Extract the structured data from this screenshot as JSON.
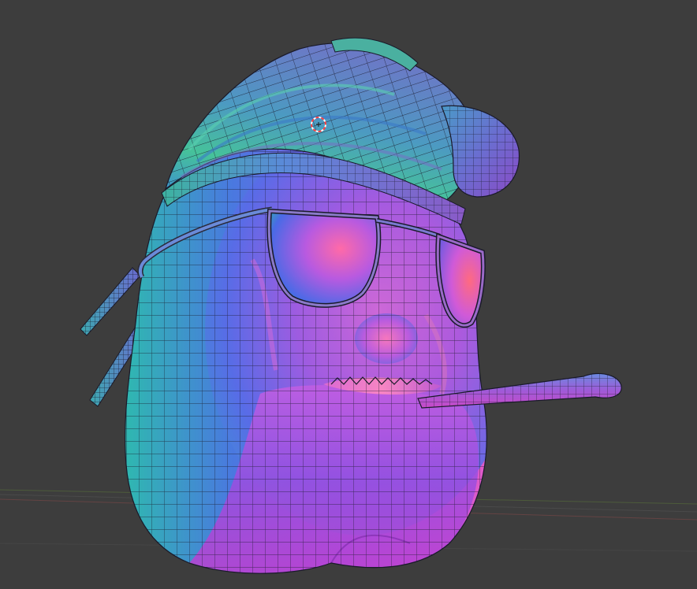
{
  "viewport": {
    "background_color": "#3d3d3d",
    "grid_color": "#4a4a4a",
    "x_axis_color": "#8a4a4a",
    "y_axis_color": "#5d7a3a",
    "wireframe_color": "#1a1a2a",
    "shading": "normal-matcap",
    "overlays": {
      "wireframe": true,
      "grid_floor": true,
      "3d_cursor": true
    }
  },
  "object": {
    "name": "character-head-mesh",
    "parts": [
      "head",
      "cap",
      "cap-brim",
      "sunglasses",
      "straw",
      "back-straps",
      "teeth"
    ]
  },
  "cursor": {
    "icon": "3d-cursor-icon",
    "colors": [
      "#ff4040",
      "#ffffff"
    ]
  }
}
